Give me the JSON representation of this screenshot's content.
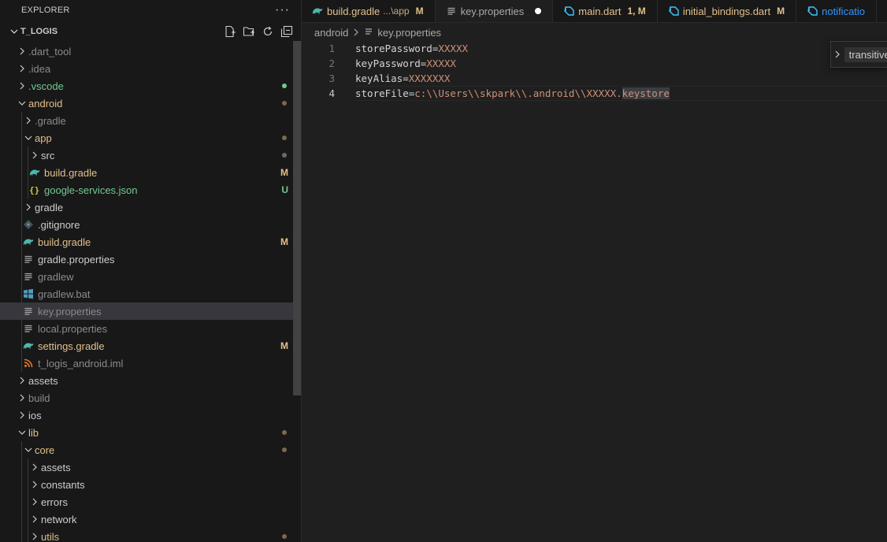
{
  "explorer": {
    "title": "EXPLORER",
    "more_label": "···",
    "project": "T_LOGIS",
    "actions": [
      "new-file-icon",
      "new-folder-icon",
      "refresh-icon",
      "collapse-all-icon"
    ],
    "items": [
      {
        "label": ".dart_tool",
        "depth": 0,
        "type": "folder",
        "expanded": false,
        "color": "#8b8b8b"
      },
      {
        "label": ".idea",
        "depth": 0,
        "type": "folder",
        "expanded": false,
        "color": "#8b8b8b"
      },
      {
        "label": ".vscode",
        "depth": 0,
        "type": "folder",
        "expanded": false,
        "color": "#73c991",
        "dot": "#73c991"
      },
      {
        "label": "android",
        "depth": 0,
        "type": "folder",
        "expanded": true,
        "color": "#e2c08d",
        "dot": "#7a6a4c"
      },
      {
        "label": ".gradle",
        "depth": 1,
        "type": "folder",
        "expanded": false,
        "color": "#8b8b8b"
      },
      {
        "label": "app",
        "depth": 1,
        "type": "folder",
        "expanded": true,
        "color": "#e2c08d",
        "dot": "#7a6a4c"
      },
      {
        "label": "src",
        "depth": 2,
        "type": "folder",
        "expanded": false,
        "color": "#cccccc",
        "dot": "#6b6b6b"
      },
      {
        "label": "build.gradle",
        "depth": 2,
        "type": "gradle",
        "color": "#e2c08d",
        "badge": "M",
        "badge_color": "#e2c08d"
      },
      {
        "label": "google-services.json",
        "depth": 2,
        "type": "json",
        "color": "#73c991",
        "badge": "U",
        "badge_color": "#73c991"
      },
      {
        "label": "gradle",
        "depth": 1,
        "type": "folder",
        "expanded": false,
        "color": "#cccccc"
      },
      {
        "label": ".gitignore",
        "depth": 1,
        "type": "git",
        "color": "#cccccc"
      },
      {
        "label": "build.gradle",
        "depth": 1,
        "type": "gradle",
        "color": "#e2c08d",
        "badge": "M",
        "badge_color": "#e2c08d"
      },
      {
        "label": "gradle.properties",
        "depth": 1,
        "type": "lines",
        "color": "#cccccc"
      },
      {
        "label": "gradlew",
        "depth": 1,
        "type": "lines",
        "color": "#8b8b8b"
      },
      {
        "label": "gradlew.bat",
        "depth": 1,
        "type": "windows",
        "color": "#8b8b8b"
      },
      {
        "label": "key.properties",
        "depth": 1,
        "type": "lines",
        "color": "#8b8b8b",
        "selected": true
      },
      {
        "label": "local.properties",
        "depth": 1,
        "type": "lines",
        "color": "#8b8b8b"
      },
      {
        "label": "settings.gradle",
        "depth": 1,
        "type": "gradle",
        "color": "#e2c08d",
        "badge": "M",
        "badge_color": "#e2c08d"
      },
      {
        "label": "t_logis_android.iml",
        "depth": 1,
        "type": "rss",
        "color": "#8b8b8b"
      },
      {
        "label": "assets",
        "depth": 0,
        "type": "folder",
        "expanded": false,
        "color": "#cccccc"
      },
      {
        "label": "build",
        "depth": 0,
        "type": "folder",
        "expanded": false,
        "color": "#8b8b8b"
      },
      {
        "label": "ios",
        "depth": 0,
        "type": "folder",
        "expanded": false,
        "color": "#cccccc"
      },
      {
        "label": "lib",
        "depth": 0,
        "type": "folder",
        "expanded": true,
        "color": "#e2c08d",
        "dot": "#7a6a4c"
      },
      {
        "label": "core",
        "depth": 1,
        "type": "folder",
        "expanded": true,
        "color": "#e2c08d",
        "dot": "#7a6a4c"
      },
      {
        "label": "assets",
        "depth": 2,
        "type": "folder",
        "expanded": false,
        "color": "#cccccc"
      },
      {
        "label": "constants",
        "depth": 2,
        "type": "folder",
        "expanded": false,
        "color": "#cccccc"
      },
      {
        "label": "errors",
        "depth": 2,
        "type": "folder",
        "expanded": false,
        "color": "#cccccc"
      },
      {
        "label": "network",
        "depth": 2,
        "type": "folder",
        "expanded": false,
        "color": "#cccccc"
      },
      {
        "label": "utils",
        "depth": 2,
        "type": "folder",
        "expanded": false,
        "color": "#e2c08d",
        "dot": "#7a6a4c"
      }
    ]
  },
  "tabs": [
    {
      "label": "build.gradle",
      "sub": "...\\app",
      "badge": "M",
      "icon": "gradle-icon",
      "color": "#e2c08d"
    },
    {
      "label": "key.properties",
      "icon": "lines-icon",
      "color": "#a9a9a9",
      "active": true,
      "modified": true
    },
    {
      "label": "main.dart",
      "badge": "1, M",
      "icon": "dart-icon",
      "color": "#e2c08d"
    },
    {
      "label": "initial_bindings.dart",
      "badge": "M",
      "icon": "dart-icon",
      "color": "#e2c08d"
    },
    {
      "label": "notificatio",
      "icon": "dart-icon",
      "color": "#3794ff"
    }
  ],
  "breadcrumb": {
    "folder": "android",
    "file": "key.properties"
  },
  "code": [
    {
      "num": "1",
      "key": "storePassword",
      "value": "XXXXX"
    },
    {
      "num": "2",
      "key": "keyPassword",
      "value": "XXXXX"
    },
    {
      "num": "3",
      "key": "keyAlias",
      "value": "XXXXXXX"
    },
    {
      "num": "4",
      "key": "storeFile",
      "value_pre": "c:\\\\Users\\\\skpark\\\\.android\\\\XXXXX.",
      "value_hl": "keystore",
      "current": true
    }
  ],
  "peek": {
    "label": "transitive"
  },
  "colors": {
    "accent_modified": "#e2c08d",
    "accent_untracked": "#73c991",
    "string_value": "#ce9178"
  }
}
